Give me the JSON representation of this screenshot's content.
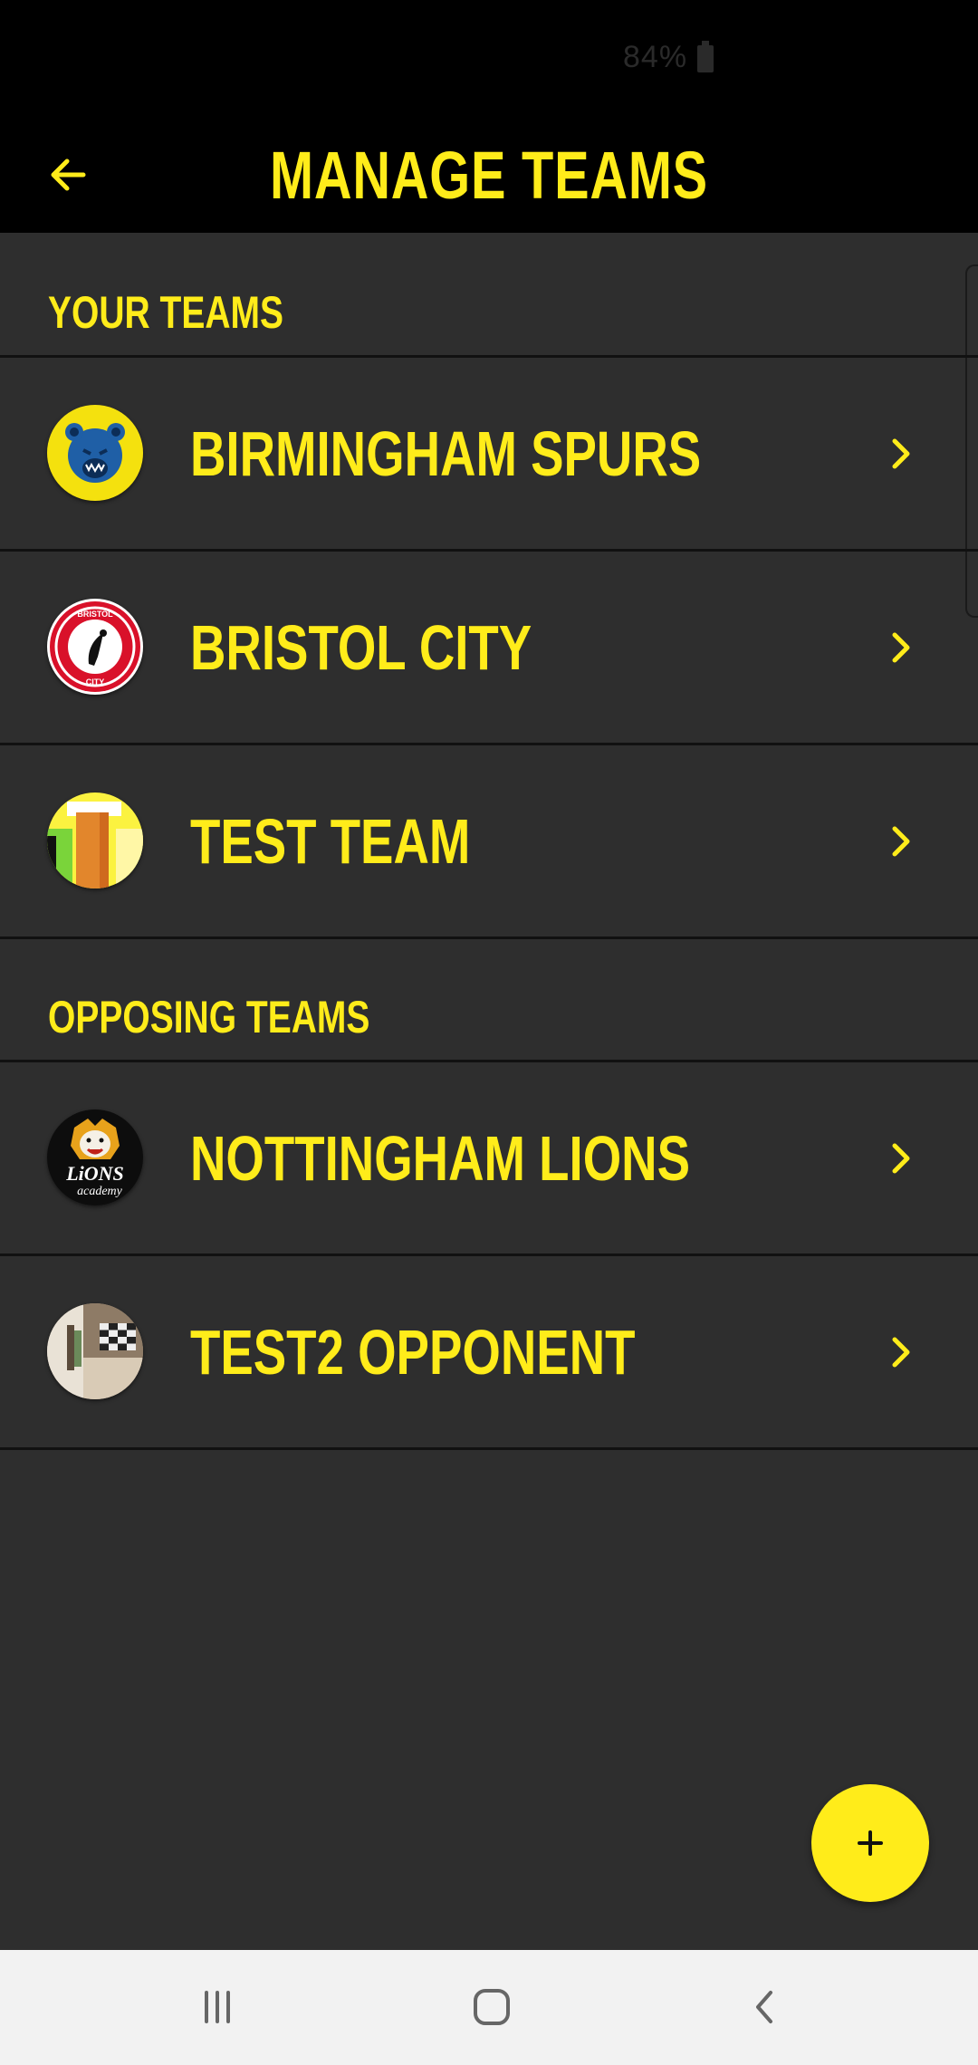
{
  "status_bar": {
    "battery": "84%"
  },
  "header": {
    "title": "MANAGE TEAMS"
  },
  "sections": [
    {
      "title": "YOUR TEAMS",
      "teams": [
        {
          "name": "BIRMINGHAM SPURS",
          "logo_icon": "blue-bear-logo-icon"
        },
        {
          "name": "BRISTOL CITY",
          "logo_icon": "bristol-city-crest-icon"
        },
        {
          "name": "TEST TEAM",
          "logo_icon": "test-team-image-icon"
        }
      ]
    },
    {
      "title": "OPPOSING TEAMS",
      "teams": [
        {
          "name": "NOTTINGHAM LIONS",
          "logo_icon": "lions-academy-logo-icon"
        },
        {
          "name": "TEST2 OPPONENT",
          "logo_icon": "room-photo-icon"
        }
      ]
    }
  ],
  "fab": {
    "label": "+",
    "icon": "plus-icon"
  },
  "nav": {
    "recents_icon": "recents-icon",
    "home_icon": "home-icon",
    "back_icon": "back-icon"
  },
  "colors": {
    "accent": "#ffec1a",
    "background": "#2e2e2e",
    "header": "#000000",
    "nav_bar": "#f2f2f2"
  }
}
